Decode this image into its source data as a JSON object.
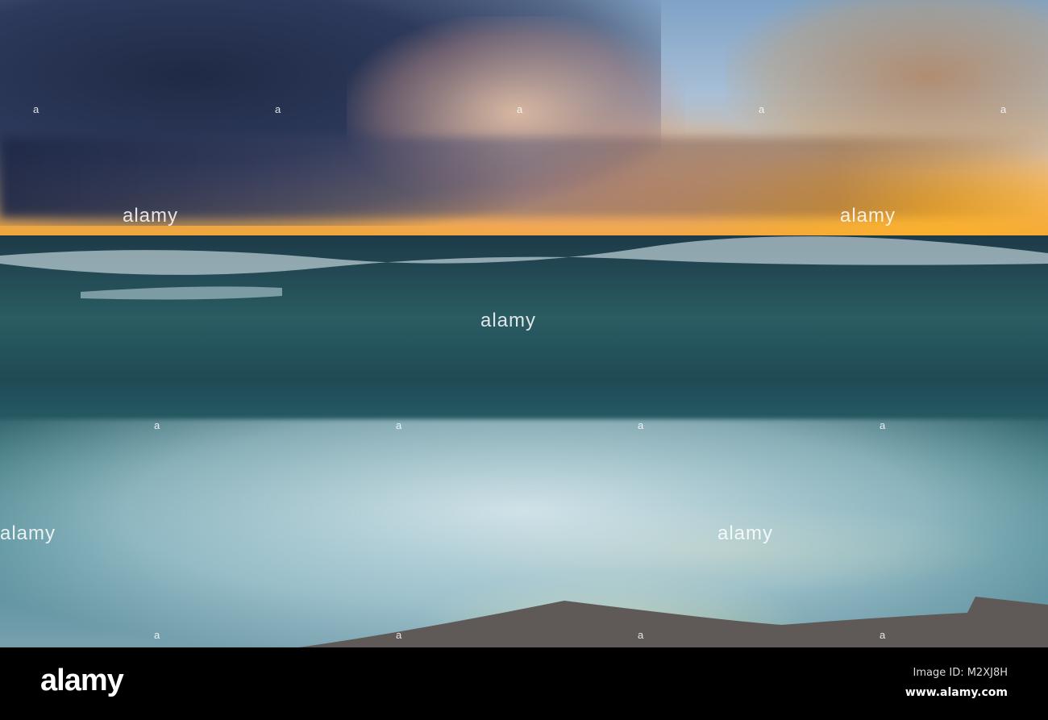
{
  "photo": {
    "subject": "sunset seascape",
    "watermark_small": "a",
    "watermark_big": "alamy"
  },
  "colors": {
    "sunset": "#f0a53a",
    "sea": "#2b6a70",
    "foam": "#e6f0f5",
    "footer": "#000000"
  },
  "footer": {
    "logo": "alamy",
    "image_id": "Image ID: M2XJ8H",
    "website": "www.alamy.com"
  }
}
